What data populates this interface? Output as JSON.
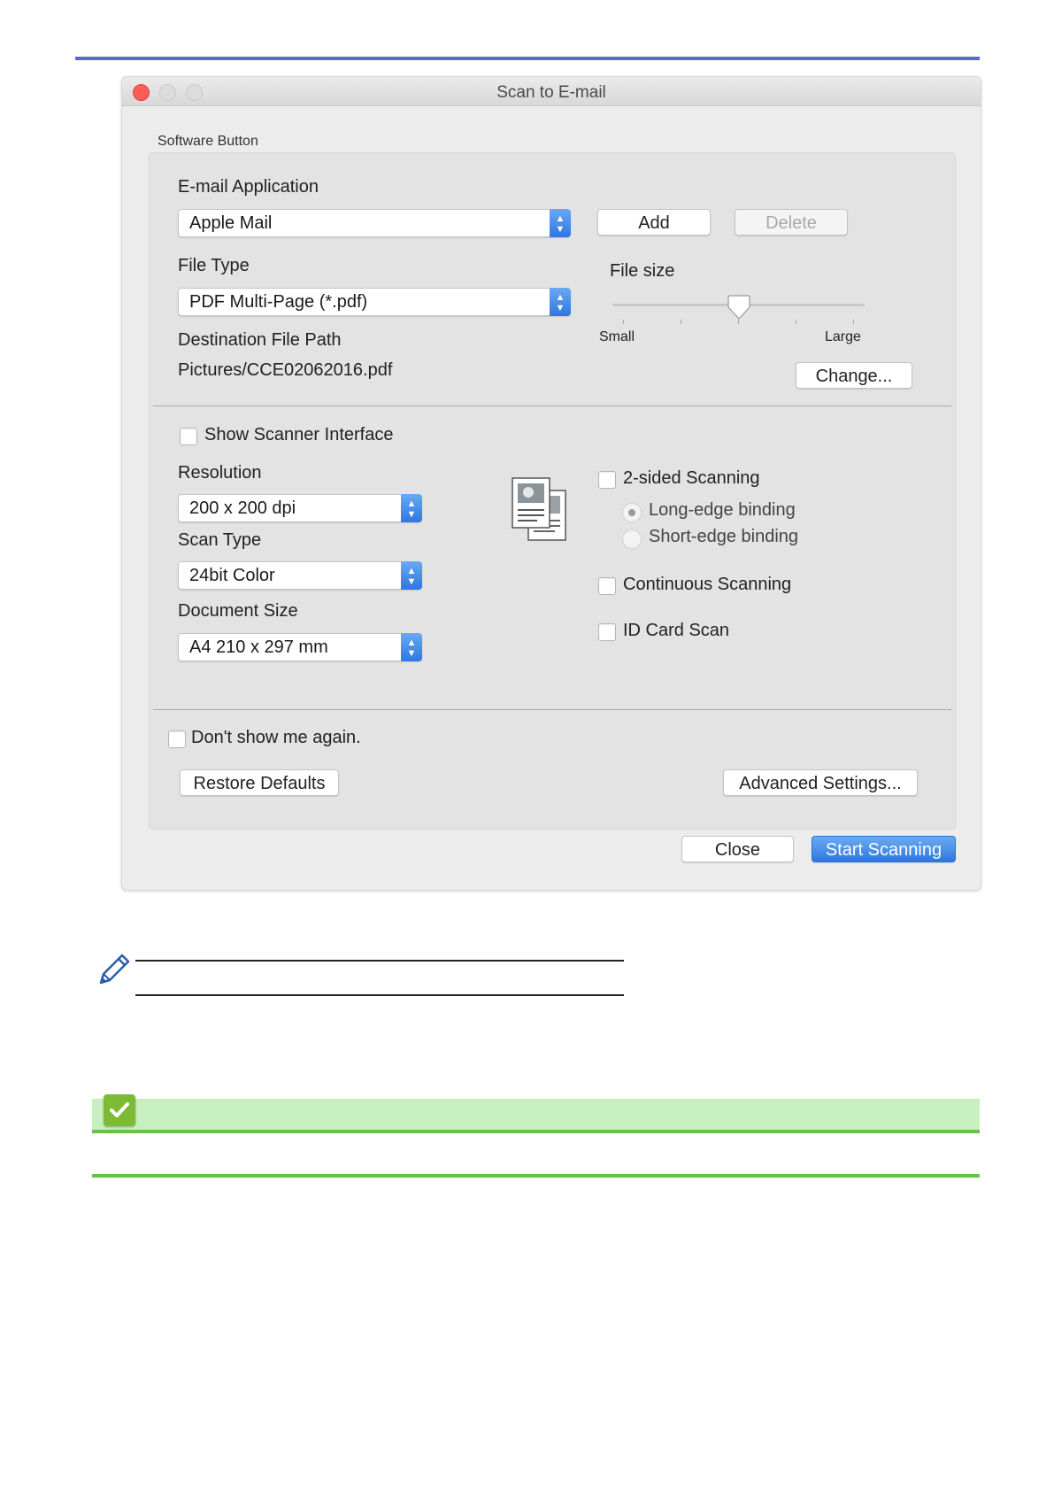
{
  "window": {
    "title": "Scan to E-mail",
    "group_label": "Software Button"
  },
  "email": {
    "label": "E-mail Application",
    "selected": "Apple Mail",
    "add_label": "Add",
    "delete_label": "Delete"
  },
  "file_type": {
    "label": "File Type",
    "selected": "PDF Multi-Page (*.pdf)"
  },
  "file_size": {
    "label": "File size",
    "min_label": "Small",
    "max_label": "Large",
    "level": 0.5
  },
  "destination": {
    "label": "Destination File Path",
    "path": "Pictures/CCE02062016.pdf",
    "change_label": "Change..."
  },
  "scanner": {
    "show_interface_label": "Show Scanner Interface",
    "show_interface_checked": false,
    "resolution_label": "Resolution",
    "resolution_value": "200 x 200 dpi",
    "scan_type_label": "Scan Type",
    "scan_type_value": "24bit Color",
    "doc_size_label": "Document Size",
    "doc_size_value": "A4 210 x 297 mm"
  },
  "options": {
    "two_sided_label": "2-sided Scanning",
    "long_edge_label": "Long-edge binding",
    "short_edge_label": "Short-edge binding",
    "continuous_label": "Continuous Scanning",
    "id_card_label": "ID Card Scan"
  },
  "footer": {
    "dont_show_label": "Don't show me again.",
    "restore_label": "Restore Defaults",
    "advanced_label": "Advanced Settings...",
    "close_label": "Close",
    "start_label": "Start Scanning"
  },
  "icons": {
    "note": "pencil-icon",
    "check": "checkmark-icon",
    "scan_preview": "document-preview-icon"
  },
  "colors": {
    "accent": "#2f77e0",
    "top_rule": "#5b6bc7",
    "green_band": "#c8efc0",
    "green_rule": "#66c24a",
    "close_dot": "#fc5d57"
  }
}
